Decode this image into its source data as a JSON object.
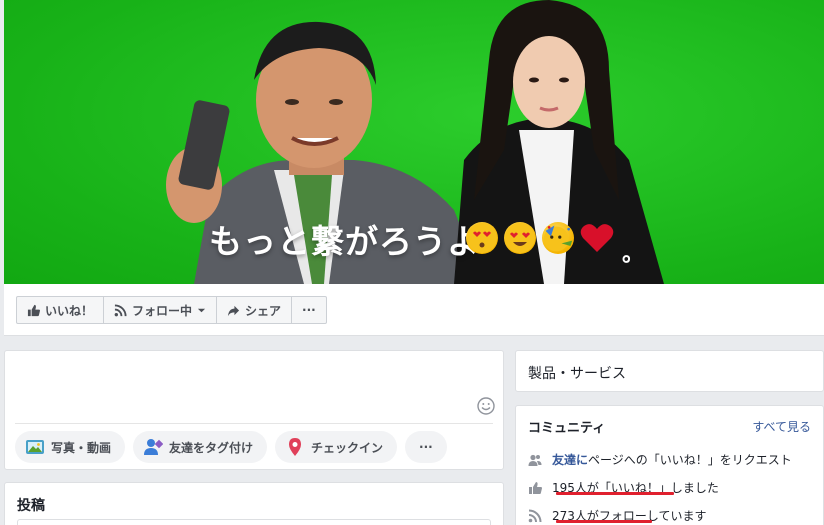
{
  "cover": {
    "caption": "もっと繋がろうよ",
    "caption_end": "。",
    "background_color": "#1fb81f"
  },
  "action_bar": {
    "like_label": "いいね！",
    "follow_label": "フォロー中",
    "share_label": "シェア",
    "more_label": "···",
    "icons": [
      "thumbs-up-icon",
      "rss-icon",
      "chevron-down-icon",
      "share-arrow-icon"
    ]
  },
  "composer": {
    "photo_video_label": "写真・動画",
    "tag_friends_label": "友達をタグ付け",
    "checkin_label": "チェックイン",
    "more_label": "···"
  },
  "posts_section": {
    "title": "投稿"
  },
  "products": {
    "title": "製品・サービス"
  },
  "community": {
    "title": "コミュニティ",
    "see_all": "すべて見る",
    "invite_link": "友達に",
    "invite_text": "ページへの「いいね！」をリクエスト",
    "likes_text": "195人が「いいね！」",
    "likes_suffix": "しました",
    "follows_text": "273人がフォロー",
    "follows_suffix": "しています",
    "highlight_color": "#e0202e",
    "link_color": "#365899"
  }
}
